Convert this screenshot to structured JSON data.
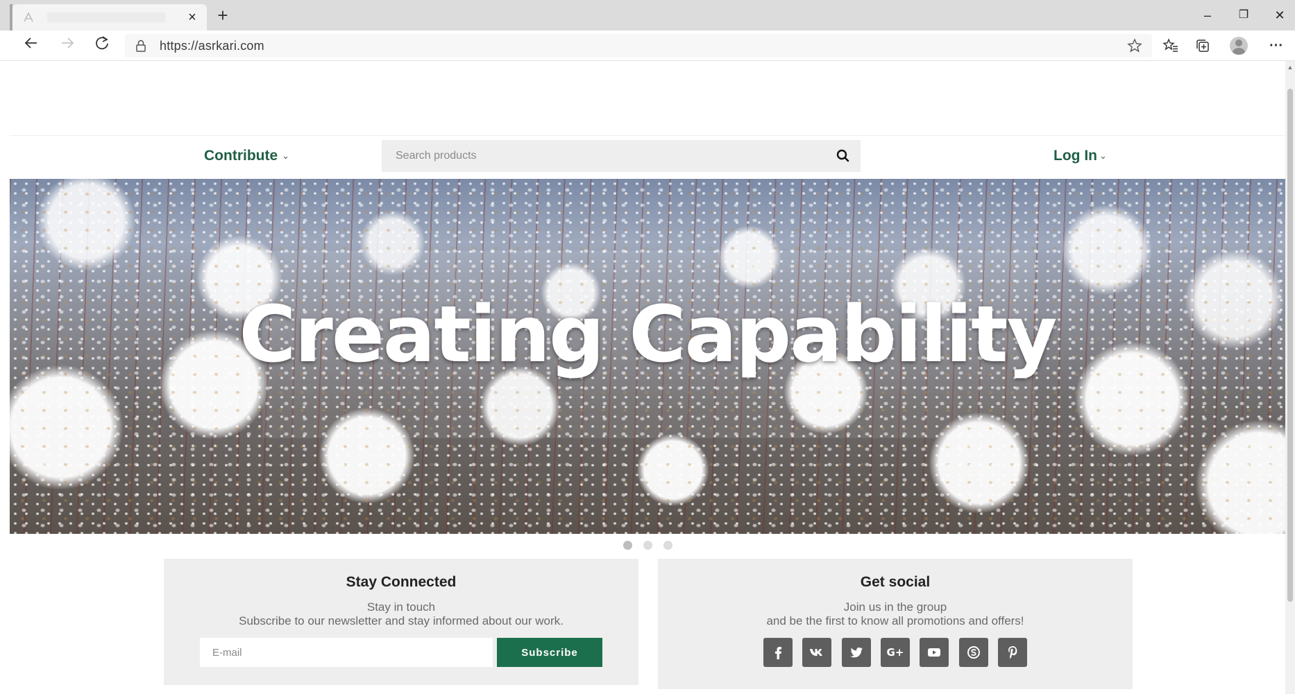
{
  "browser": {
    "tab": {
      "close_glyph": "×"
    },
    "newtab_glyph": "+",
    "window": {
      "minimize": "–",
      "restore": "❐",
      "close": "✕"
    },
    "url": "https://asrkari.com",
    "icons": [
      "back-icon",
      "forward-icon",
      "refresh-icon",
      "lock-icon",
      "star-icon",
      "favorites-icon",
      "collections-icon",
      "profile-icon",
      "more-icon"
    ]
  },
  "nav": {
    "contribute": "Contribute",
    "login": "Log In",
    "search_placeholder": "Search products"
  },
  "hero": {
    "title": "Creating Capability",
    "slides": 3,
    "active_slide": 1
  },
  "newsletter": {
    "title": "Stay Connected",
    "line1": "Stay in touch",
    "line2": "Subscribe to our newsletter and stay informed about our work.",
    "email_placeholder": "E-mail",
    "button": "Subscribe"
  },
  "social": {
    "title": "Get social",
    "line1": "Join us in the group",
    "line2": "and be the first to know all promotions and offers!",
    "networks": [
      "facebook-icon",
      "vk-icon",
      "twitter-icon",
      "google-plus-icon",
      "youtube-icon",
      "skype-icon",
      "pinterest-icon"
    ]
  },
  "colors": {
    "brand_green": "#1c6f4c",
    "nav_text": "#1f5f44",
    "card_bg": "#eeeeee",
    "social_bg": "#5e5e5e"
  }
}
